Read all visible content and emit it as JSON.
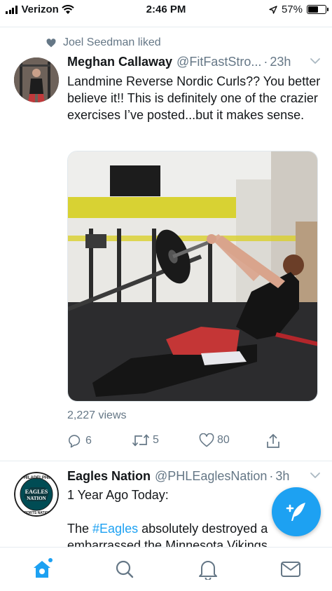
{
  "status_bar": {
    "carrier": "Verizon",
    "time": "2:46 PM",
    "battery": "57%",
    "battery_level": 0.57
  },
  "tweet1": {
    "social_context": "Joel Seedman liked",
    "display_name": "Meghan Callaway",
    "handle": "@FitFastStro...",
    "separator": "·",
    "time": "23h",
    "text": "Landmine Reverse Nordic Curls?? You better believe it!! This is definitely one of the crazier exercises I’ve posted...but it makes sense.",
    "views": "2,227 views",
    "reply_count": "6",
    "retweet_count": "5",
    "like_count": "80"
  },
  "tweet2": {
    "display_name": "Eagles Nation",
    "handle": "@PHLEaglesNation",
    "separator": "·",
    "time": "3h",
    "line1": "1 Year Ago Today:",
    "line2_prefix": "The ",
    "hashtag": "#Eagles",
    "line2_suffix": " absolutely destroyed a",
    "line3": "embarrassed the Minnesota Vikings",
    "logo_text_top": "PHILADELPHIA",
    "logo_text_middle_1": "EAGLES",
    "logo_text_middle_2": "NATION",
    "logo_text_bottom": "SPORTS NATION"
  },
  "tab_bar": {
    "tabs": [
      "home-icon",
      "search-icon",
      "notifications-icon",
      "messages-icon"
    ],
    "active": "home-icon"
  },
  "colors": {
    "accent": "#1da1f2",
    "text": "#14171a",
    "secondary": "#657786",
    "separator": "#e6ecf0"
  }
}
